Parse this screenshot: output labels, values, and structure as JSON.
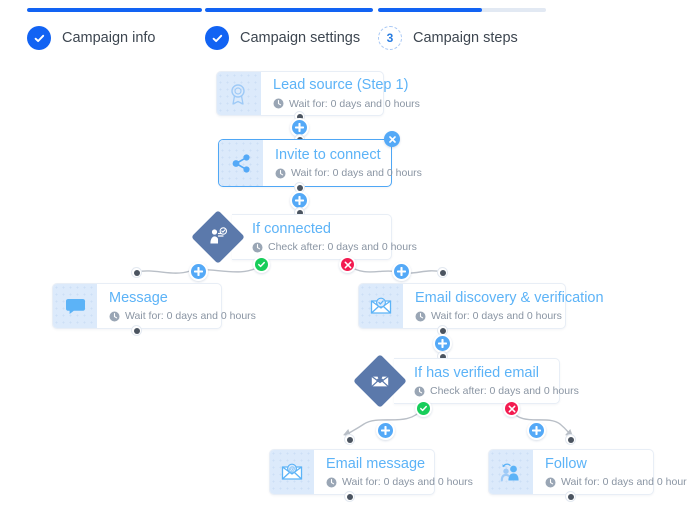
{
  "stepper": {
    "steps": [
      {
        "label": "Campaign info",
        "state": "done",
        "badge": "check-icon",
        "progress": 100
      },
      {
        "label": "Campaign settings",
        "state": "done",
        "badge": "check-icon",
        "progress": 100
      },
      {
        "label": "Campaign steps",
        "state": "current",
        "badge": "3",
        "progress": 62
      }
    ],
    "colors": {
      "accent": "#1263f3",
      "track": "#e2e9f3",
      "current_ring": "#a8c8f5"
    }
  },
  "flow": {
    "colors": {
      "node_title": "#5cb3f7",
      "node_sub": "#8a95a3",
      "icon_panel": "#dceafb",
      "diamond": "#5b79ab",
      "edge": "#b9bfc7",
      "plus_button": "#54a9f7",
      "yes_badge": "#17cd5a",
      "no_badge": "#f31b50",
      "selected_border": "#4fa7f5"
    },
    "nodes": [
      {
        "id": "lead-source",
        "title": "Lead source (Step 1)",
        "subtitle": "Wait for: 0 days and 0 hours",
        "icon": "badge-ribbon-icon",
        "shape": "card",
        "selected": false
      },
      {
        "id": "invite-connect",
        "title": "Invite to connect",
        "subtitle": "Wait for: 0 days and 0 hours",
        "icon": "share-icon",
        "shape": "card",
        "selected": true
      },
      {
        "id": "if-connected",
        "title": "If connected",
        "subtitle": "Check after: 0 days and 0 hours",
        "icon": "person-check-icon",
        "shape": "diamond",
        "selected": false
      },
      {
        "id": "message",
        "title": "Message",
        "subtitle": "Wait for: 0 days and 0 hours",
        "icon": "chat-bubble-icon",
        "shape": "card",
        "selected": false
      },
      {
        "id": "email-discovery",
        "title": "Email discovery & verification",
        "subtitle": "Wait for: 0 days and 0 hours",
        "icon": "envelope-check-icon",
        "shape": "card",
        "selected": false
      },
      {
        "id": "if-verified",
        "title": "If has verified email",
        "subtitle": "Check after: 0 days and 0 hours",
        "icon": "envelope-user-icon",
        "shape": "diamond",
        "selected": false
      },
      {
        "id": "email-message",
        "title": "Email message",
        "subtitle": "Wait for: 0 days and 0 hours",
        "icon": "envelope-at-icon",
        "shape": "card",
        "selected": false
      },
      {
        "id": "follow",
        "title": "Follow",
        "subtitle": "Wait for: 0 days and 0 hours",
        "icon": "follow-user-icon",
        "shape": "card",
        "selected": false
      }
    ]
  }
}
